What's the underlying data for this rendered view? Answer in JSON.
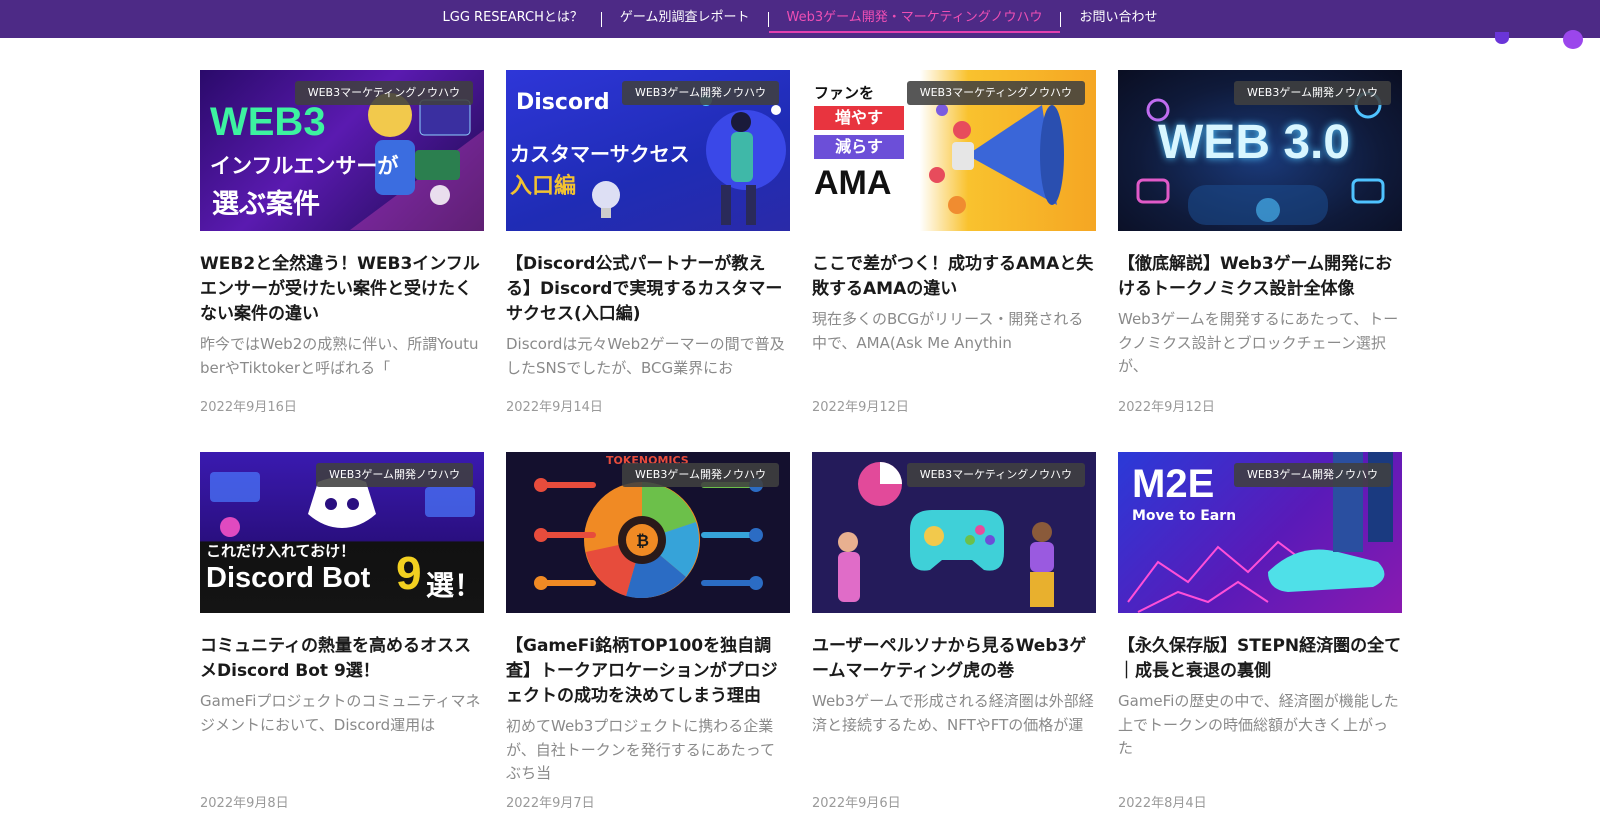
{
  "nav": {
    "items": [
      {
        "label": "LGG RESEARCHとは？",
        "active": false
      },
      {
        "label": "ゲーム別調査レポート",
        "active": false
      },
      {
        "label": "Web3ゲーム開発・マーケティングノウハウ",
        "active": true
      },
      {
        "label": "お問い合わせ",
        "active": false
      }
    ]
  },
  "colors": {
    "nav_bg": "#4d2a86",
    "active": "#ee4fb4",
    "underline": "#e23fae"
  },
  "articles": [
    {
      "category": "WEB3マーケティングノウハウ",
      "title": "WEB2と全然違う！WEB3インフルエンサーが受けたい案件と受けたくない案件の違い",
      "excerpt": "昨今ではWeb2の成熟に伴い、所謂YoutuberやTiktokerと呼ばれる「",
      "date": "2022年9月16日",
      "thumb_text": [
        "WEB3",
        "インフルエンサーが",
        "選ぶ案件"
      ]
    },
    {
      "category": "WEB3ゲーム開発ノウハウ",
      "title": "【Discord公式パートナーが教える】Discordで実現するカスタマーサクセス(入口編)",
      "excerpt": "Discordは元々Web2ゲーマーの間で普及したSNSでしたが、BCG業界にお",
      "date": "2022年9月14日",
      "thumb_text": [
        "Discord",
        "カスタマーサクセス",
        "入口編"
      ]
    },
    {
      "category": "WEB3マーケティングノウハウ",
      "title": "ここで差がつく！成功するAMAと失敗するAMAの違い",
      "excerpt": "現在多くのBCGがリリース・開発される中で、AMA(Ask Me Anythin",
      "date": "2022年9月12日",
      "thumb_text": [
        "ファンを",
        "増やす",
        "減らす",
        "AMA"
      ]
    },
    {
      "category": "WEB3ゲーム開発ノウハウ",
      "title": "【徹底解説】Web3ゲーム開発におけるトークノミクス設計全体像",
      "excerpt": "Web3ゲームを開発するにあたって、トークノミクス設計とブロックチェーン選択が、",
      "date": "2022年9月12日",
      "thumb_text": [
        "WEB 3.0"
      ]
    },
    {
      "category": "WEB3ゲーム開発ノウハウ",
      "title": "コミュニティの熱量を高めるオススメDiscord Bot 9選！",
      "excerpt": "GameFiプロジェクトのコミュニティマネジメントにおいて、Discord運用は",
      "date": "2022年9月8日",
      "thumb_text": [
        "これだけ入れておけ！",
        "Discord Bot",
        "9",
        "選！"
      ]
    },
    {
      "category": "WEB3ゲーム開発ノウハウ",
      "title": "【GameFi銘柄TOP100を独自調査】トークアロケーションがプロジェクトの成功を決めてしまう理由",
      "excerpt": "初めてWeb3プロジェクトに携わる企業が、自社トークンを発行するにあたってぶち当",
      "date": "2022年9月7日",
      "thumb_text": [
        "TOKENOMICS"
      ]
    },
    {
      "category": "WEB3マーケティングノウハウ",
      "title": "ユーザーペルソナから見るWeb3ゲームマーケティング虎の巻",
      "excerpt": "Web3ゲームで形成される経済圏は外部経済と接続するため、NFTやFTの価格が運",
      "date": "2022年9月6日",
      "thumb_text": []
    },
    {
      "category": "WEB3ゲーム開発ノウハウ",
      "title": "【永久保存版】STEPN経済圏の全て｜成長と衰退の裏側",
      "excerpt": "GameFiの歴史の中で、経済圏が機能した上でトークンの時価総額が大きく上がった",
      "date": "2022年8月4日",
      "thumb_text": [
        "M2E",
        "Move to Earn"
      ]
    }
  ]
}
